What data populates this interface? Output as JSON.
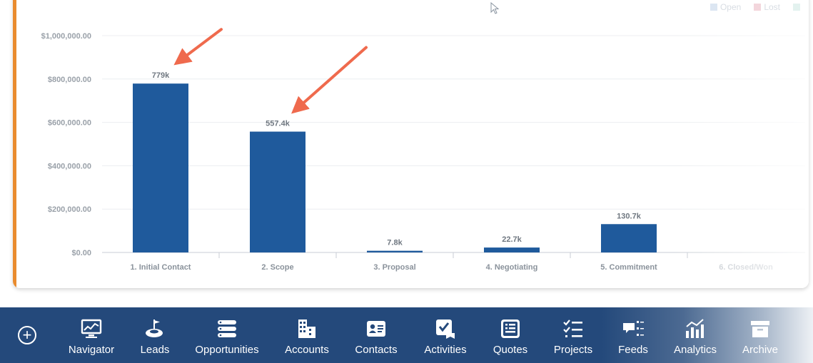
{
  "chart_data": {
    "type": "bar",
    "categories": [
      "1. Initial Contact",
      "2. Scope",
      "3. Proposal",
      "4. Negotiating",
      "5. Commitment",
      "6. Closed/Won"
    ],
    "series": [
      {
        "name": "Open",
        "values": [
          779000,
          557400,
          7800,
          22700,
          130700,
          0
        ],
        "color": "#1f5a9c"
      }
    ],
    "data_labels": [
      "779k",
      "557.4k",
      "7.8k",
      "22.7k",
      "130.7k",
      ""
    ],
    "y_ticks": [
      0,
      200000,
      400000,
      600000,
      800000,
      1000000
    ],
    "y_tick_labels": [
      "$0.00",
      "$200,000.00",
      "$400,000.00",
      "$600,000.00",
      "$800,000.00",
      "$1,000,000.00"
    ],
    "ylim": [
      0,
      1000000
    ],
    "grid": true,
    "legend": {
      "position": "top-right",
      "entries": [
        {
          "name": "Open",
          "color": "#dce6f2"
        },
        {
          "name": "Lost",
          "color": "#f3d6dc"
        },
        {
          "name": "",
          "color": "#e3f2ef"
        }
      ]
    },
    "annotations": [
      {
        "type": "arrow",
        "points_to": "1. Initial Contact",
        "color": "#ef6a4d"
      },
      {
        "type": "arrow",
        "points_to": "2. Scope",
        "color": "#ef6a4d"
      }
    ]
  },
  "navbar": {
    "items": [
      {
        "label": "Navigator",
        "icon": "navigator-icon"
      },
      {
        "label": "Leads",
        "icon": "leads-icon"
      },
      {
        "label": "Opportunities",
        "icon": "opportunities-icon"
      },
      {
        "label": "Accounts",
        "icon": "accounts-icon"
      },
      {
        "label": "Contacts",
        "icon": "contacts-icon"
      },
      {
        "label": "Activities",
        "icon": "activities-icon"
      },
      {
        "label": "Quotes",
        "icon": "quotes-icon"
      },
      {
        "label": "Projects",
        "icon": "projects-icon"
      },
      {
        "label": "Feeds",
        "icon": "feeds-icon"
      },
      {
        "label": "Analytics",
        "icon": "analytics-icon"
      },
      {
        "label": "Archive",
        "icon": "archive-icon"
      }
    ],
    "add_icon": "plus-circle-icon"
  }
}
